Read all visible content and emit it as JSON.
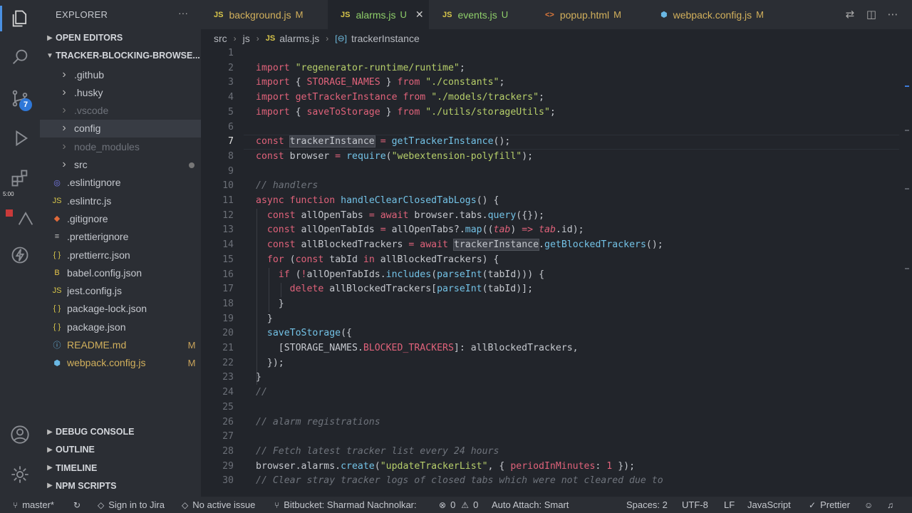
{
  "activity": {
    "scm_badge": "7",
    "timer": "5:00"
  },
  "sidebar": {
    "title": "EXPLORER",
    "more": "···",
    "open_editors": "OPEN EDITORS",
    "project": "TRACKER-BLOCKING-BROWSE...",
    "items": [
      {
        "label": ".github",
        "type": "folder",
        "status": ""
      },
      {
        "label": ".husky",
        "type": "folder",
        "status": ""
      },
      {
        "label": ".vscode",
        "type": "folder-dim",
        "status": ""
      },
      {
        "label": "config",
        "type": "folder",
        "status": ""
      },
      {
        "label": "node_modules",
        "type": "folder-dim",
        "status": ""
      },
      {
        "label": "src",
        "type": "folder",
        "status": "dot"
      },
      {
        "label": ".eslintignore",
        "type": "eslint",
        "status": ""
      },
      {
        "label": ".eslintrc.js",
        "type": "js",
        "status": ""
      },
      {
        "label": ".gitignore",
        "type": "git",
        "status": ""
      },
      {
        "label": ".prettierignore",
        "type": "prettier",
        "status": ""
      },
      {
        "label": ".prettierrc.json",
        "type": "json",
        "status": ""
      },
      {
        "label": "babel.config.json",
        "type": "babel",
        "status": ""
      },
      {
        "label": "jest.config.js",
        "type": "js",
        "status": ""
      },
      {
        "label": "package-lock.json",
        "type": "json",
        "status": ""
      },
      {
        "label": "package.json",
        "type": "json",
        "status": ""
      },
      {
        "label": "README.md",
        "type": "info",
        "status": "M"
      },
      {
        "label": "webpack.config.js",
        "type": "webpack",
        "status": "M"
      }
    ],
    "bottom_sections": [
      "DEBUG CONSOLE",
      "OUTLINE",
      "TIMELINE",
      "NPM SCRIPTS"
    ]
  },
  "tabs": [
    {
      "icon": "JS",
      "label": "background.js",
      "status": "M"
    },
    {
      "icon": "JS",
      "label": "alarms.js",
      "status": "U"
    },
    {
      "icon": "JS",
      "label": "events.js",
      "status": "U"
    },
    {
      "icon": "<>",
      "label": "popup.html",
      "status": "M"
    },
    {
      "icon": "⬢",
      "label": "webpack.config.js",
      "status": "M"
    }
  ],
  "breadcrumb": [
    "src",
    "js",
    "alarms.js",
    "trackerInstance"
  ],
  "editor": {
    "current_line": 7,
    "line_numbers": [
      "1",
      "2",
      "3",
      "4",
      "5",
      "6",
      "7",
      "8",
      "9",
      "10",
      "11",
      "12",
      "13",
      "14",
      "15",
      "16",
      "17",
      "18",
      "19",
      "20",
      "21",
      "22",
      "23",
      "24",
      "25",
      "26",
      "27",
      "28",
      "29",
      "30"
    ]
  },
  "status": {
    "branch": "master*",
    "jira": "Sign in to Jira",
    "issue": "No active issue",
    "bitbucket": "Bitbucket: Sharmad Nachnolkar:",
    "errors": "0",
    "warnings": "0",
    "auto_attach": "Auto Attach: Smart",
    "spaces": "Spaces: 2",
    "encoding": "UTF-8",
    "eol": "LF",
    "language": "JavaScript",
    "prettier": "Prettier"
  },
  "colors": {
    "accent": "#2f78d8",
    "keyword": "#e0627a",
    "string": "#b7cf6a",
    "function": "#73c2e6",
    "modified": "#c9a35a",
    "untracked": "#7fbf5a"
  }
}
